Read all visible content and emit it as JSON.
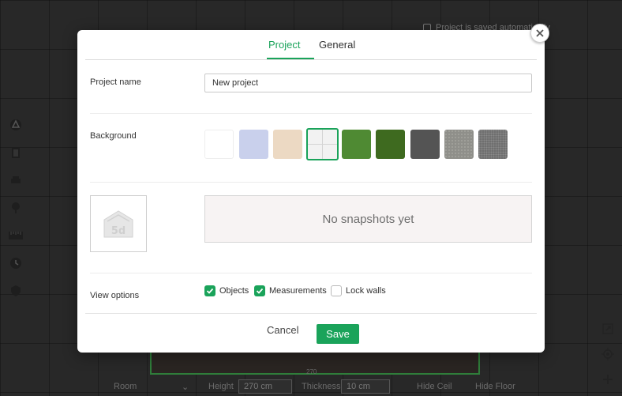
{
  "background_app": {
    "top_option": "Project is saved automatically",
    "floor_label": "270",
    "bottom_bar": {
      "room_select": "Room",
      "height_label": "Height",
      "height_value": "270 cm",
      "thickness_label": "Thickness",
      "thickness_value": "10 cm",
      "hide_ceil": "Hide Ceil",
      "hide_floor": "Hide Floor"
    },
    "left_tools": [
      "vertex-icon",
      "door-icon",
      "sofa-icon",
      "tree-icon",
      "ruler-icon",
      "clock-icon",
      "shield-icon"
    ],
    "right_tools": [
      "expand-icon",
      "locate-icon",
      "zoom-in-icon"
    ]
  },
  "modal": {
    "tabs": [
      {
        "label": "Project",
        "active": true
      },
      {
        "label": "General",
        "active": false
      }
    ],
    "project_name": {
      "label": "Project name",
      "value": "New project"
    },
    "background": {
      "label": "Background",
      "swatches": [
        {
          "name": "white",
          "color": "#ffffff"
        },
        {
          "name": "lavender",
          "color": "#c9d0ec"
        },
        {
          "name": "beige",
          "color": "#ecd9c3"
        },
        {
          "name": "grid",
          "color": "#f2f2f2",
          "selected": true
        },
        {
          "name": "grass-light",
          "color": "#4f8a33"
        },
        {
          "name": "grass-dark",
          "color": "#3e6a1f"
        },
        {
          "name": "asphalt",
          "color": "#545454"
        },
        {
          "name": "stone",
          "color": "#8f8f8a"
        },
        {
          "name": "granite",
          "color": "#6f6f6f"
        }
      ]
    },
    "snapshots": {
      "empty_text": "No snapshots yet",
      "logo_icon": "5d-logo-icon"
    },
    "view_options": {
      "label": "View options",
      "options": [
        {
          "label": "Objects",
          "checked": true
        },
        {
          "label": "Measurements",
          "checked": true
        },
        {
          "label": "Lock walls",
          "checked": false
        }
      ]
    },
    "buttons": {
      "cancel": "Cancel",
      "save": "Save"
    },
    "accent_color": "#1aa35a"
  }
}
